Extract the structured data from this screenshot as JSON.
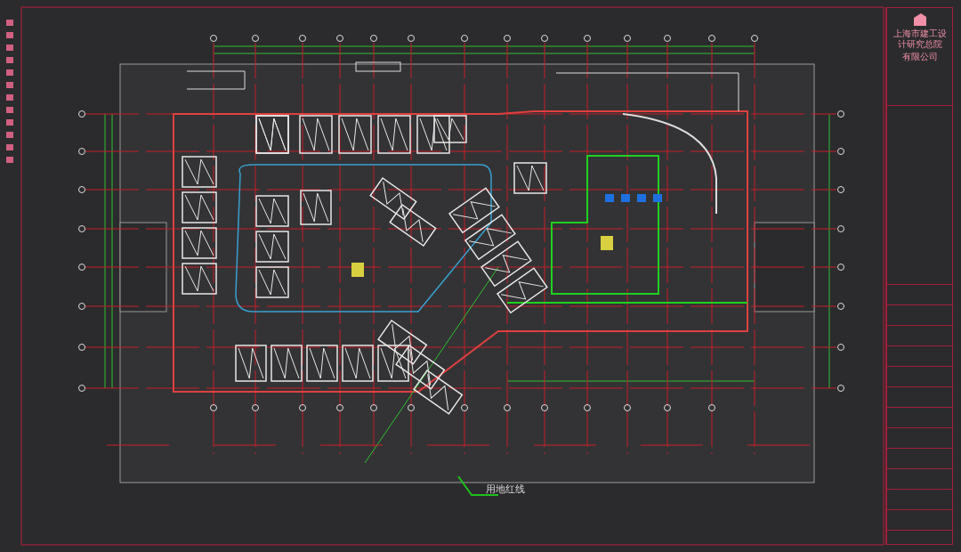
{
  "title_block": {
    "company_lines": [
      "上海市建工设计研究总院",
      "有限公司"
    ]
  },
  "plan": {
    "labels": [
      {
        "text": "用地红线"
      }
    ]
  }
}
